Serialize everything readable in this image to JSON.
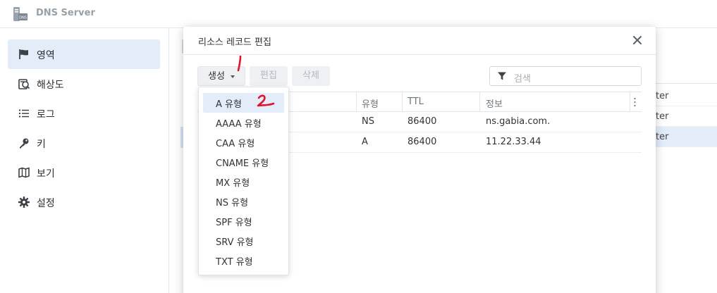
{
  "app": {
    "title": "DNS Server",
    "icon_text": "DNS"
  },
  "sidebar": {
    "items": [
      {
        "label": "영역",
        "icon": "flag-icon",
        "active": true
      },
      {
        "label": "해상도",
        "icon": "resolution-icon",
        "active": false
      },
      {
        "label": "로그",
        "icon": "list-icon",
        "active": false
      },
      {
        "label": "키",
        "icon": "key-icon",
        "active": false
      },
      {
        "label": "보기",
        "icon": "map-icon",
        "active": false
      },
      {
        "label": "설정",
        "icon": "gear-icon",
        "active": false
      }
    ]
  },
  "background": {
    "rows": [
      "ter",
      "ter",
      "ter"
    ]
  },
  "modal": {
    "title": "리소스 레코드 편집",
    "toolbar": {
      "create_label": "생성",
      "edit_label": "편집",
      "delete_label": "삭제",
      "search_placeholder": "검색"
    },
    "table": {
      "columns": [
        "유형",
        "TTL",
        "정보"
      ],
      "rows": [
        {
          "type": "NS",
          "ttl": "86400",
          "info": "ns.gabia.com."
        },
        {
          "type": "A",
          "ttl": "86400",
          "info": "11.22.33.44"
        }
      ]
    },
    "dropdown": {
      "items": [
        "A 유형",
        "AAAA 유형",
        "CAA 유형",
        "CNAME 유형",
        "MX 유형",
        "NS 유형",
        "SPF 유형",
        "SRV 유형",
        "TXT 유형"
      ]
    }
  },
  "annotations": [
    "1",
    "2"
  ],
  "colors": {
    "accent": "#e3edfa",
    "annotation": "#e0142a"
  }
}
